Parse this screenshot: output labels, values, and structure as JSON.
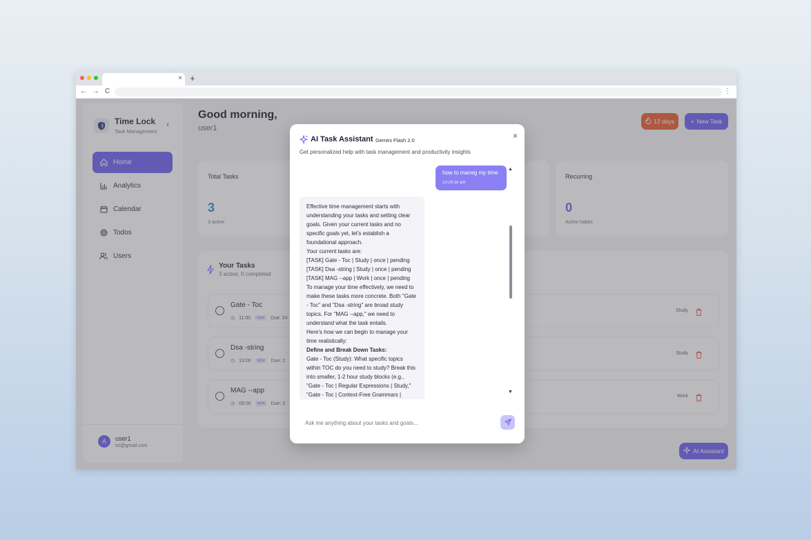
{
  "browser": {
    "tab_close": "×",
    "tab_new": "+",
    "nav_back": "←",
    "nav_forward": "→",
    "nav_reload": "C",
    "menu": "⋮"
  },
  "sidebar": {
    "title": "Time Lock",
    "subtitle": "Task Management",
    "collapse": "‹",
    "items": [
      {
        "label": "Home",
        "icon": "home-icon"
      },
      {
        "label": "Analytics",
        "icon": "analytics-icon"
      },
      {
        "label": "Calendar",
        "icon": "calendar-icon"
      },
      {
        "label": "Todos",
        "icon": "target-icon"
      },
      {
        "label": "Users",
        "icon": "users-icon"
      }
    ],
    "active_item": "Home",
    "user": {
      "name": "user1",
      "email": "tst@gmail.com",
      "avatar_letter": "A"
    }
  },
  "header": {
    "greeting": "Good morning,",
    "username": "user1",
    "streak_label": "12 days",
    "new_task_label": "New Task"
  },
  "stats": {
    "total": {
      "label": "Total Tasks",
      "value": "3",
      "sub": "3 active"
    },
    "recurring": {
      "label": "Recurring",
      "value": "0",
      "sub": "Active habits"
    }
  },
  "tasks": {
    "title": "Your Tasks",
    "subtitle": "3 active, 0 completed",
    "items": [
      {
        "name": "Gate - Toc",
        "time": "11:00",
        "badge": "once",
        "due": "Due: 24",
        "category": "Study"
      },
      {
        "name": "Dsa -string",
        "time": "13:00",
        "badge": "once",
        "due": "Due: 2",
        "category": "Study"
      },
      {
        "name": "MAG --app",
        "time": "09:00",
        "badge": "once",
        "due": "Due: 2",
        "category": "Work"
      }
    ]
  },
  "ai_button_label": "AI Assistant",
  "modal": {
    "title": "AI Task Assistant",
    "model": "Gemini Flash 2.0",
    "close": "×",
    "description": "Get personalized help with task management and productivity insights",
    "user_message": {
      "text": "how  to maneg my time",
      "time": "10:29:18 am"
    },
    "ai_lines": [
      {
        "text": "Effective time management starts with understanding your tasks and setting clear goals. Given your current tasks and no specific goals yet, let's establish a foundational approach."
      },
      {
        "text": "Your current tasks are:"
      },
      {
        "text": "[TASK] Gate - Toc | Study | once | pending"
      },
      {
        "text": "[TASK] Dsa -string | Study | once | pending"
      },
      {
        "text": "[TASK] MAG --app | Work | once | pending"
      },
      {
        "text": "To manage your time effectively, we need to make these tasks more concrete. Both \"Gate - Toc\" and \"Dsa -string\" are broad study topics. For \"MAG --app,\" we need to understand what the task entails."
      },
      {
        "text": "Here's how we can begin to manage your time realistically:"
      },
      {
        "text": "Define and Break Down Tasks:",
        "bold": true
      },
      {
        "text": "Gate - Toc (Study): What specific topics within TOC do you need to study? Break this into smaller, 1-2 hour study blocks (e.g., \"Gate - Toc | Regular Expressions | Study,\" \"Gate - Toc | Context-Free Grammars |"
      }
    ],
    "input_placeholder": "Ask me anything about your tasks and goals...",
    "scroll_up": "▲",
    "scroll_down": "▼"
  },
  "colors": {
    "accent": "#6a5cf0",
    "streak": "#e8582a",
    "total_value": "#1b8fd6",
    "recurring_value": "#6a5cf0",
    "trash": "#e04848"
  }
}
